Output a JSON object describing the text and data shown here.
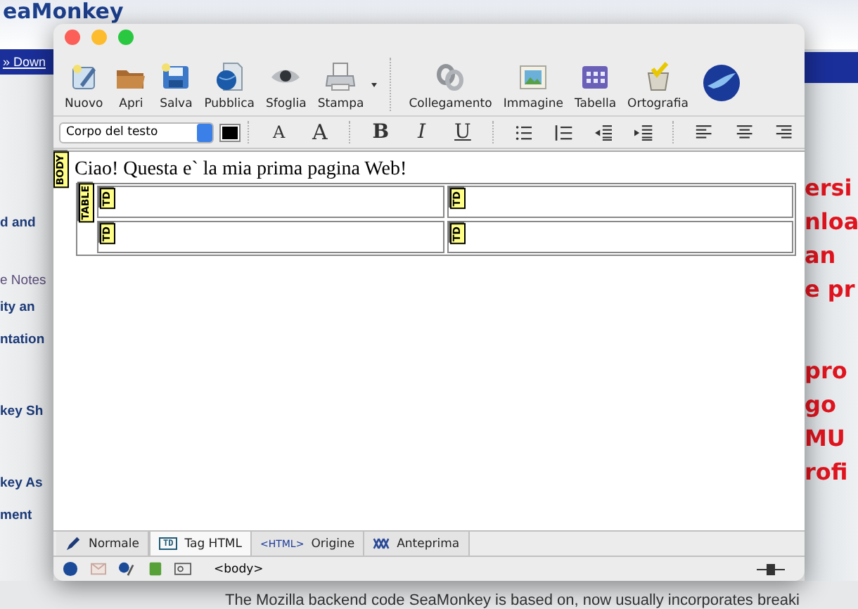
{
  "background_page": {
    "logo": "eaMonkey",
    "nav_link": "» Down",
    "sidebar_items": [
      "d and",
      "e Notes",
      "ity an",
      "ntation",
      "key Sh",
      "key As",
      "ment"
    ],
    "headlines": [
      "ersi",
      "nloa",
      "an",
      "e pr",
      "pro",
      "go",
      "MU",
      "rofi"
    ],
    "body_text": "The Mozilla backend code SeaMonkey is based on, now usually incorporates breaki"
  },
  "window": {
    "toolbar": [
      {
        "kind": "new",
        "label": "Nuovo"
      },
      {
        "kind": "open",
        "label": "Apri"
      },
      {
        "kind": "save",
        "label": "Salva"
      },
      {
        "kind": "publish",
        "label": "Pubblica"
      },
      {
        "kind": "browse",
        "label": "Sfoglia"
      },
      {
        "kind": "print",
        "label": "Stampa"
      },
      {
        "kind": "link",
        "label": "Collegamento"
      },
      {
        "kind": "image",
        "label": "Immagine"
      },
      {
        "kind": "table",
        "label": "Tabella"
      },
      {
        "kind": "spell",
        "label": "Ortografia"
      }
    ],
    "paragraph_style": "Corpo del testo",
    "format_buttons": [
      {
        "kind": "smaller",
        "label": "A"
      },
      {
        "kind": "larger",
        "label": "A"
      },
      {
        "kind": "bold",
        "label": "B"
      },
      {
        "kind": "italic",
        "label": "I"
      },
      {
        "kind": "underline",
        "label": "U"
      },
      {
        "kind": "bullets"
      },
      {
        "kind": "numbers"
      },
      {
        "kind": "outdent"
      },
      {
        "kind": "indent"
      },
      {
        "kind": "align-left"
      },
      {
        "kind": "align-center"
      },
      {
        "kind": "align-right"
      }
    ],
    "editor": {
      "body_tag": "BODY",
      "text": "Ciao! Questa e` la mia prima pagina Web!",
      "table_tag": "TABLE",
      "rows": [
        [
          "TD",
          "TD"
        ],
        [
          "TD",
          "TD"
        ]
      ]
    },
    "mode_tabs": [
      {
        "kind": "normal",
        "label": "Normale",
        "selected": false
      },
      {
        "kind": "tags",
        "label": "Tag HTML",
        "badge": "TD",
        "selected": true
      },
      {
        "kind": "source",
        "label": "Origine",
        "badge": "<HTML>",
        "selected": false
      },
      {
        "kind": "preview",
        "label": "Anteprima",
        "selected": false
      }
    ],
    "status_bar": {
      "path": "<body>"
    }
  }
}
